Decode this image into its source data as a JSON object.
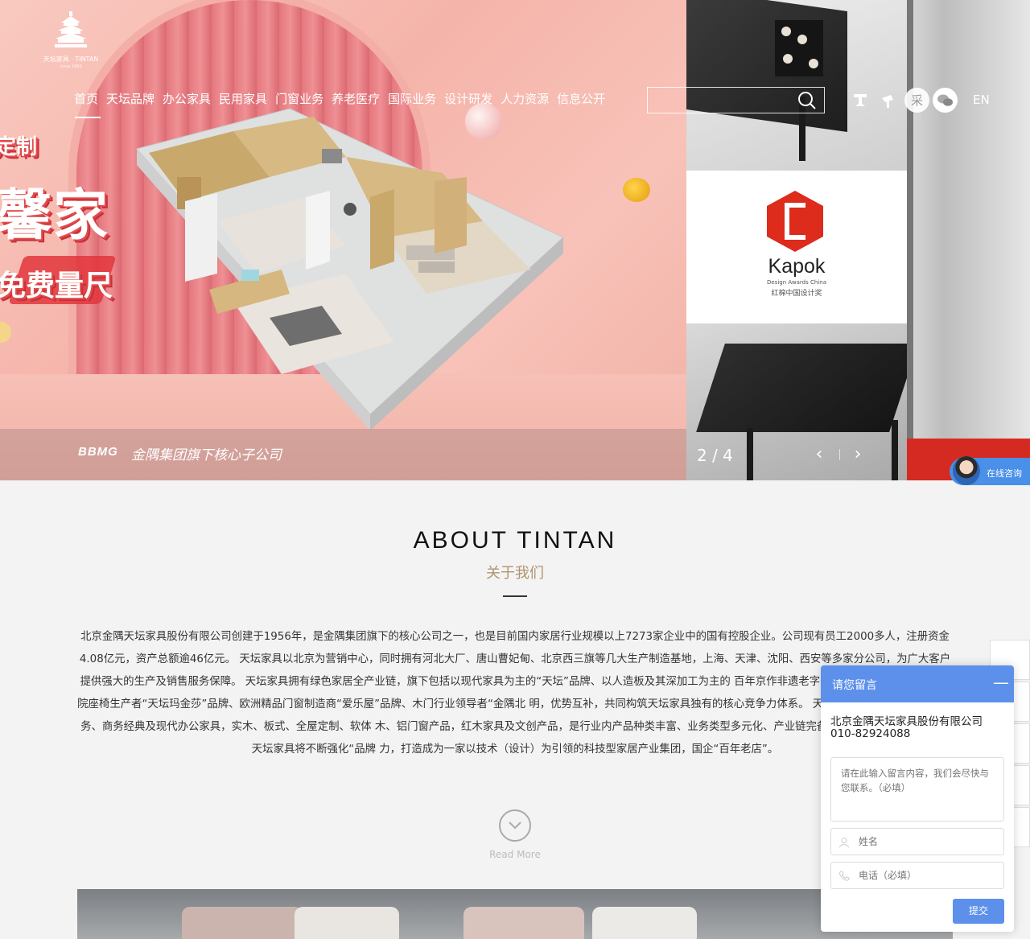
{
  "header": {
    "logo_text": "天坛家具 · TINTAN",
    "logo_since": "since 1956",
    "nav": [
      "首页",
      "天坛品牌",
      "办公家具",
      "民用家具",
      "门窗业务",
      "养老医疗",
      "国际业务",
      "设计研发",
      "人力资源",
      "信息公开"
    ],
    "search_placeholder": "",
    "tool_icons": [
      "weibo-icon",
      "douyin-icon",
      "purchase-icon",
      "wechat-icon"
    ],
    "purchase_label": "采",
    "lang": "EN"
  },
  "hero": {
    "promo_line1": "定制",
    "promo_line2": "馨家",
    "promo_line3": "免费量尺",
    "bbmg_logo": "BBMG",
    "tagline": "金隅集团旗下核心子公司",
    "award_name": "Kapok",
    "award_sub_en": "Design Awards China",
    "award_sub_cn": "红棉中国设计奖",
    "counter": "2 / 4",
    "prev": "‹",
    "next": "›"
  },
  "consult": {
    "label": "在线咨询"
  },
  "about": {
    "title": "ABOUT TINTAN",
    "subtitle": "关于我们",
    "body": "北京金隅天坛家具股份有限公司创建于1956年，是金隅集团旗下的核心公司之一，也是目前国内家居行业规模以上7273家企业中的国有控股企业。公司现有员工2000多人，注册资金4.08亿元，资产总额逾46亿元。 天坛家具以北京为营销中心，同时拥有河北大厂、唐山曹妃甸、北京西三旗等几大生产制造基地，上海、天津、沈阳、西安等多家分公司，为广大客户提供强大的生产及销售服务保障。 天坛家具拥有绿色家居全产业链，旗下包括以现代家具为主的“天坛”品牌、以人造板及其深加工为主的 百年京作非遗老字号“龙顺成”品牌、专业影剧院座椅生产者“天坛玛金莎”品牌、欧洲精品门窗制造商“爱乐屋”品牌、木门行业领导者“金隅北 明，优势互补，共同构筑天坛家具独有的核心竞争力体系。 天坛家具现有产品体系涵盖政务、商务经典及现代办公家具，实木、板式、全屋定制、软体 木、铝门窗产品，红木家具及文创产品，是行业内产品种类丰富、业务类型多元化、产业链完备的专业家具企业。 未来，天坛家具将不断强化“品牌 力，打造成为一家以技术（设计）为引领的科技型家居产业集团，国企“百年老店”。",
    "read_more": "Read More"
  },
  "message": {
    "title": "请您留言",
    "minimize": "—",
    "company": "北京金隅天坛家具股份有限公司",
    "phone": "010-82924088",
    "content_placeholder": "请在此输入留言内容，我们会尽快与您联系。（必填）",
    "name_placeholder": "姓名",
    "phone_placeholder": "电话（必填）",
    "submit": "提交"
  },
  "colors": {
    "accent": "#5c90eb",
    "subtitle_gold": "#b0946d",
    "hero_pink": "#f5b4aa"
  }
}
